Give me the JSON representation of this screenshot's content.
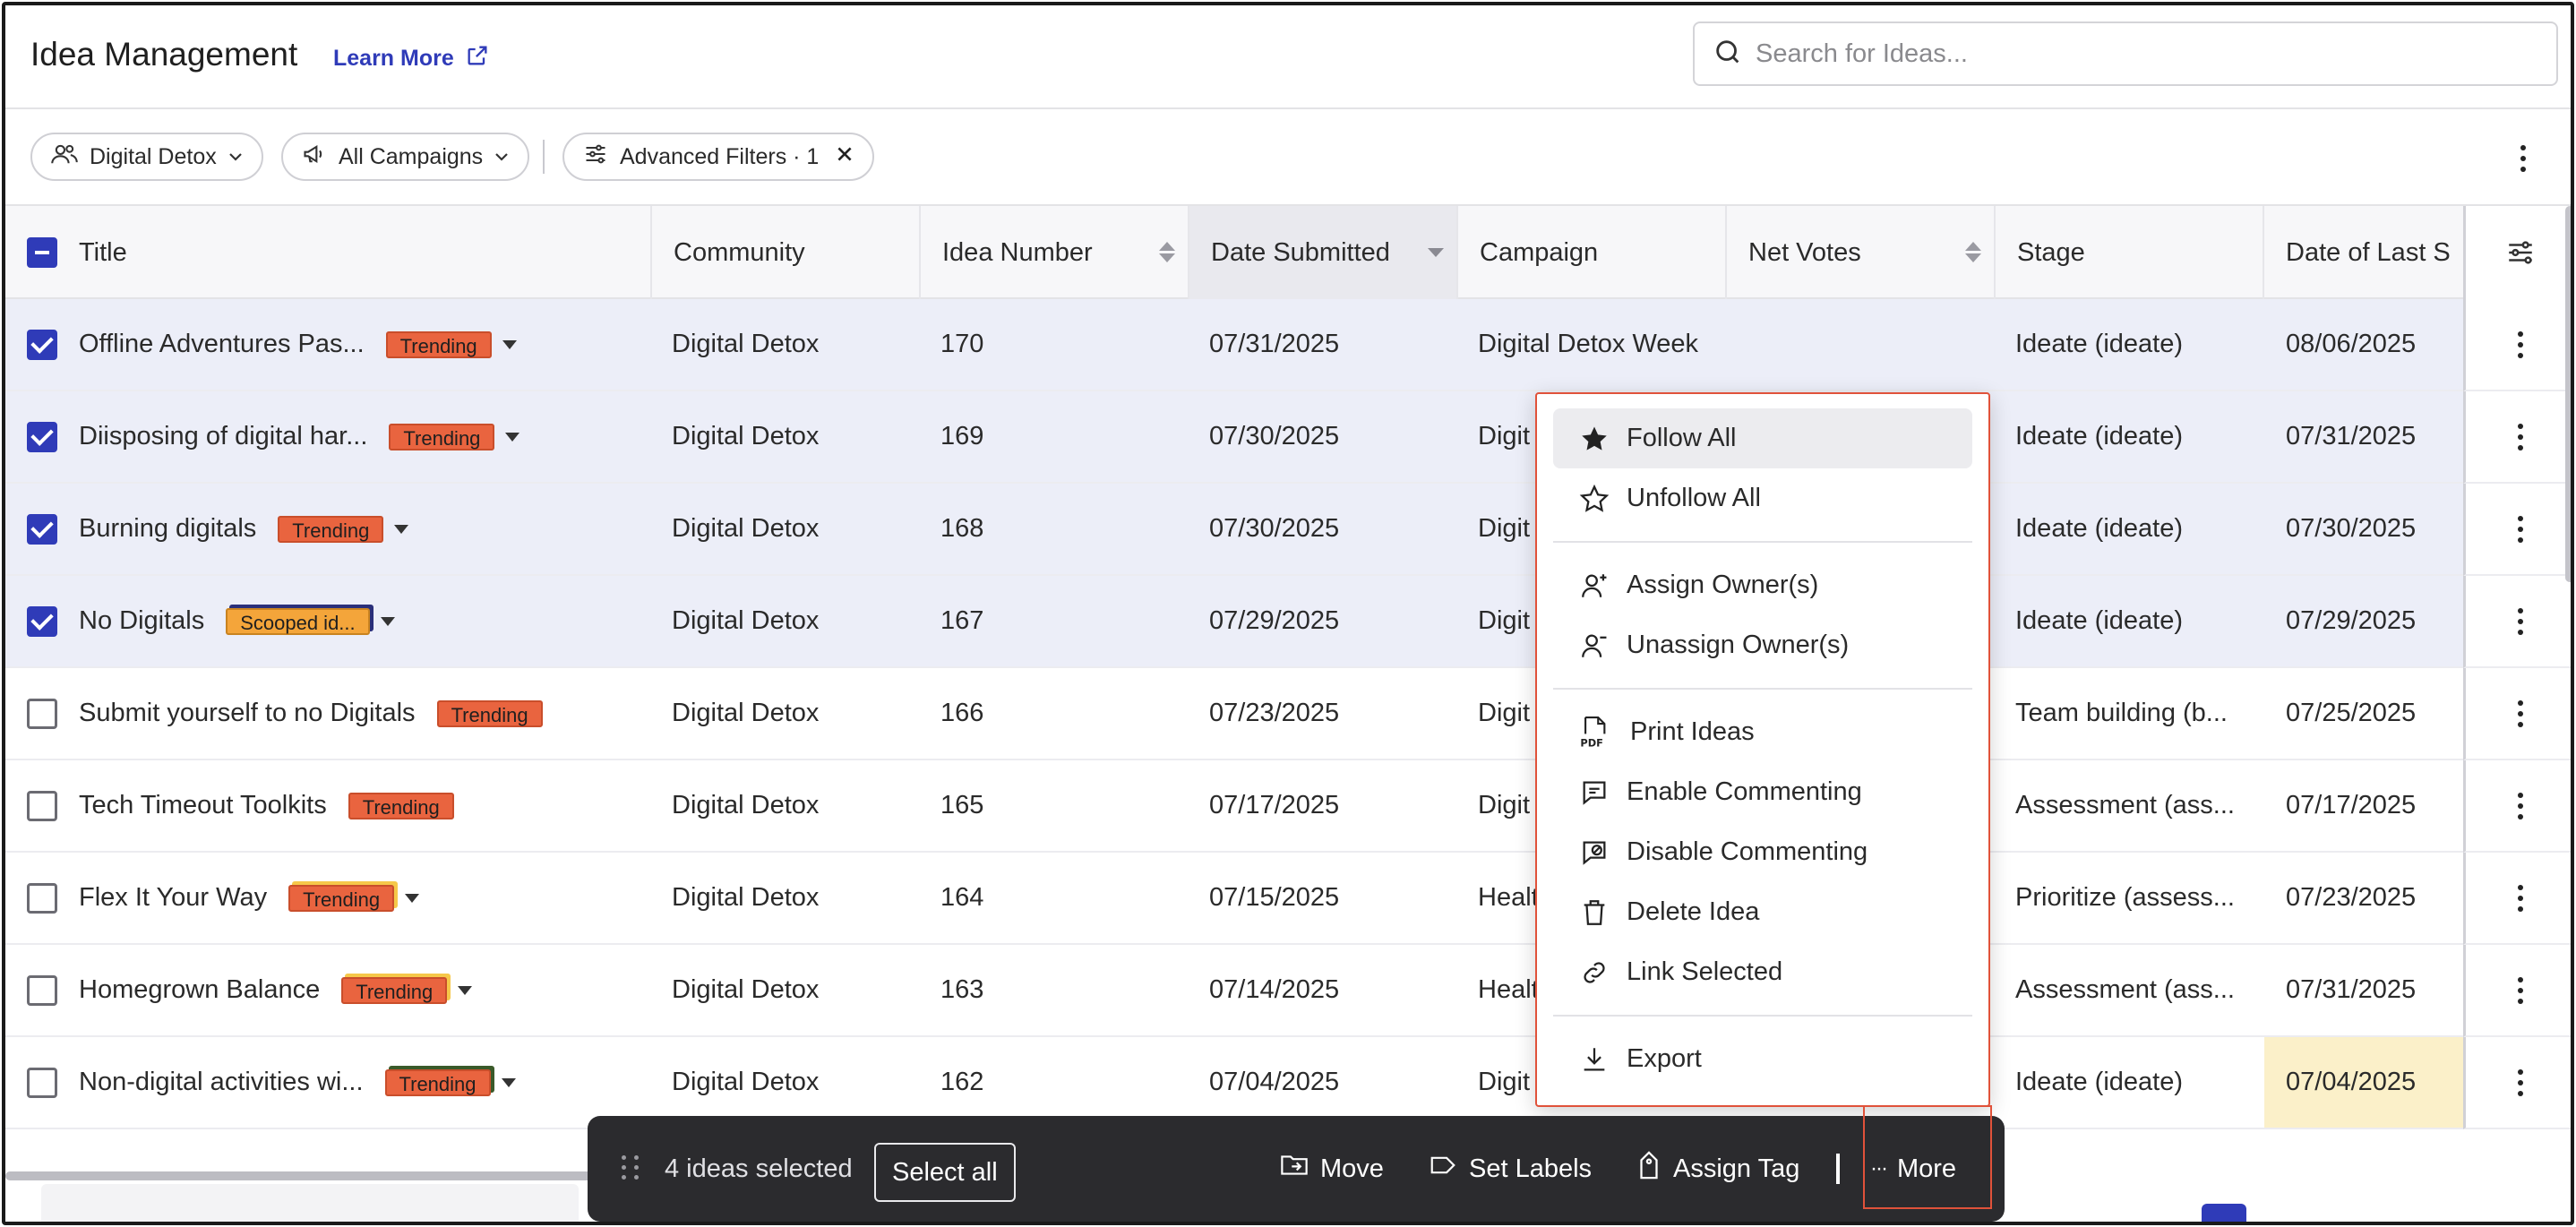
{
  "header": {
    "title": "Idea Management",
    "learn_more": "Learn More",
    "search_placeholder": "Search for Ideas..."
  },
  "filters": {
    "community": "Digital Detox",
    "campaigns": "All Campaigns",
    "advanced": "Advanced Filters · 1"
  },
  "columns": {
    "title": "Title",
    "community": "Community",
    "idea_number": "Idea Number",
    "date_submitted": "Date Submitted",
    "campaign": "Campaign",
    "net_votes": "Net Votes",
    "stage": "Stage",
    "date_last": "Date of Last S"
  },
  "rows": [
    {
      "title": "Offline Adventures Pas...",
      "badge": "Trending",
      "community": "Digital Detox",
      "number": "170",
      "date": "07/31/2025",
      "campaign": "Digital Detox Week",
      "stage": "Ideate (ideate)",
      "last": "08/06/2025"
    },
    {
      "title": "Diisposing of digital har...",
      "badge": "Trending",
      "community": "Digital Detox",
      "number": "169",
      "date": "07/30/2025",
      "campaign": "Digit",
      "stage": "Ideate (ideate)",
      "last": "07/31/2025"
    },
    {
      "title": "Burning digitals",
      "badge": "Trending",
      "community": "Digital Detox",
      "number": "168",
      "date": "07/30/2025",
      "campaign": "Digit",
      "stage": "Ideate (ideate)",
      "last": "07/30/2025"
    },
    {
      "title": "No Digitals",
      "badge": "Scooped id...",
      "community": "Digital Detox",
      "number": "167",
      "date": "07/29/2025",
      "campaign": "Digit",
      "stage": "Ideate (ideate)",
      "last": "07/29/2025"
    },
    {
      "title": "Submit yourself to no Digitals",
      "badge": "Trending",
      "community": "Digital Detox",
      "number": "166",
      "date": "07/23/2025",
      "campaign": "Digit",
      "stage": "Team building (b...",
      "last": "07/25/2025"
    },
    {
      "title": "Tech Timeout Toolkits",
      "badge": "Trending",
      "community": "Digital Detox",
      "number": "165",
      "date": "07/17/2025",
      "campaign": "Digit",
      "stage": "Assessment (ass...",
      "last": "07/17/2025"
    },
    {
      "title": "Flex It Your Way",
      "badge": "Trending",
      "community": "Digital Detox",
      "number": "164",
      "date": "07/15/2025",
      "campaign": "Healt",
      "stage": "Prioritize (assess...",
      "last": "07/23/2025"
    },
    {
      "title": "Homegrown Balance",
      "badge": "Trending",
      "community": "Digital Detox",
      "number": "163",
      "date": "07/14/2025",
      "campaign": "Healt",
      "stage": "Assessment (ass...",
      "last": "07/31/2025"
    },
    {
      "title": "Non-digital activities wi...",
      "badge": "Trending",
      "community": "Digital Detox",
      "number": "162",
      "date": "07/04/2025",
      "campaign": "Digit",
      "stage": "Ideate (ideate)",
      "last": "07/04/2025"
    }
  ],
  "menu": {
    "follow_all": "Follow All",
    "unfollow_all": "Unfollow All",
    "assign_owners": "Assign Owner(s)",
    "unassign_owners": "Unassign Owner(s)",
    "print_ideas": "Print Ideas",
    "enable_commenting": "Enable Commenting",
    "disable_commenting": "Disable Commenting",
    "delete_idea": "Delete Idea",
    "link_selected": "Link Selected",
    "export": "Export",
    "pdf_label": "PDF"
  },
  "actionbar": {
    "selected": "4 ideas selected",
    "select_all": "Select all",
    "move": "Move",
    "set_labels": "Set Labels",
    "assign_tag": "Assign Tag",
    "more": "More",
    "more_dots": "···"
  },
  "colors": {
    "accent": "#2f3bb8",
    "trending": "#e9643f",
    "scooped": "#f4a53a",
    "highlight_border": "#e0523a"
  }
}
